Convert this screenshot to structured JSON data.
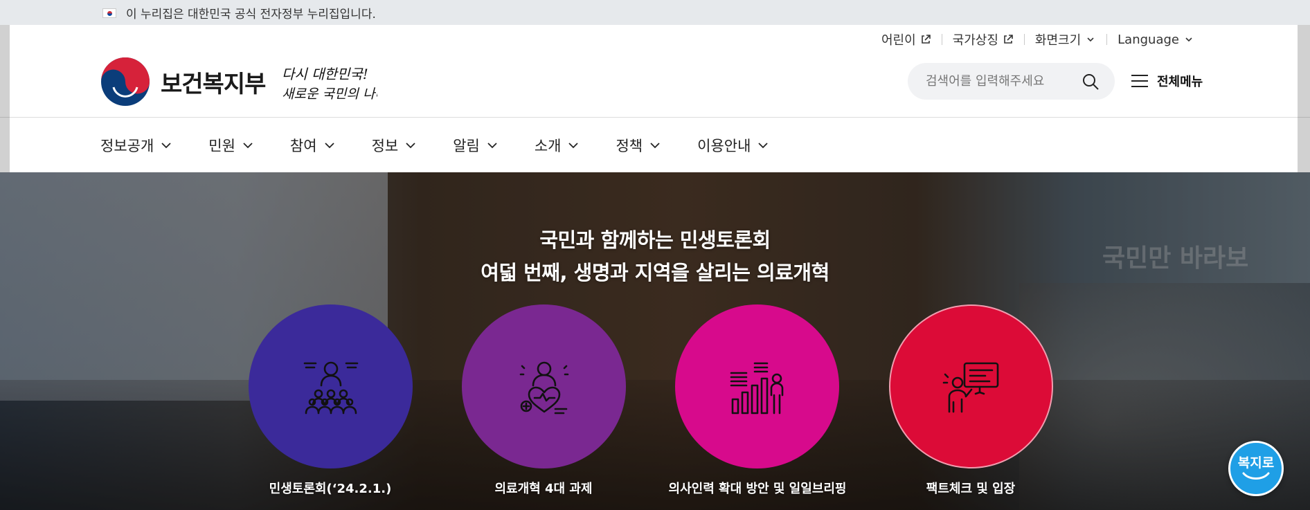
{
  "gov_bar": {
    "text": "이 누리집은 대한민국 공식 전자정부 누리집입니다."
  },
  "util": {
    "kids": "어린이",
    "national_symbols": "국가상징",
    "screen_size": "화면크기",
    "language": "Language"
  },
  "header": {
    "ministry_name": "보건복지부",
    "slogan": "다시 대한민국! 새로운 국민의 나라",
    "search_placeholder": "검색어를 입력해주세요",
    "all_menu": "전체메뉴"
  },
  "gnb": [
    {
      "label": "정보공개"
    },
    {
      "label": "민원"
    },
    {
      "label": "참여"
    },
    {
      "label": "정보"
    },
    {
      "label": "알림"
    },
    {
      "label": "소개"
    },
    {
      "label": "정책"
    },
    {
      "label": "이용안내"
    }
  ],
  "hero": {
    "title_line1": "국민과 함께하는 민생토론회",
    "title_line2": "여덟 번째, 생명과 지역을 살리는 의료개혁",
    "banner_text": "국민만 바라보",
    "items": [
      {
        "label": "민생토론회(‘24.2.1.)",
        "color": "#3b2a9a",
        "icon": "audience-speaker-icon"
      },
      {
        "label": "의료개혁 4대 과제",
        "color": "#7a2891",
        "icon": "doctor-heart-icon"
      },
      {
        "label": "의사인력 확대 방안 및 일일브리핑",
        "color": "#d70a8c",
        "icon": "growth-chart-person-icon"
      },
      {
        "label": "팩트체크 및 입장",
        "color": "#dc0b37",
        "icon": "presentation-board-icon"
      }
    ]
  },
  "bokjiro": {
    "label": "복지로"
  },
  "colors": {
    "gov_bar_bg": "#e6e9ec",
    "search_bg": "#f1f2f4",
    "bokjiro_blue": "#1f9fe6"
  }
}
